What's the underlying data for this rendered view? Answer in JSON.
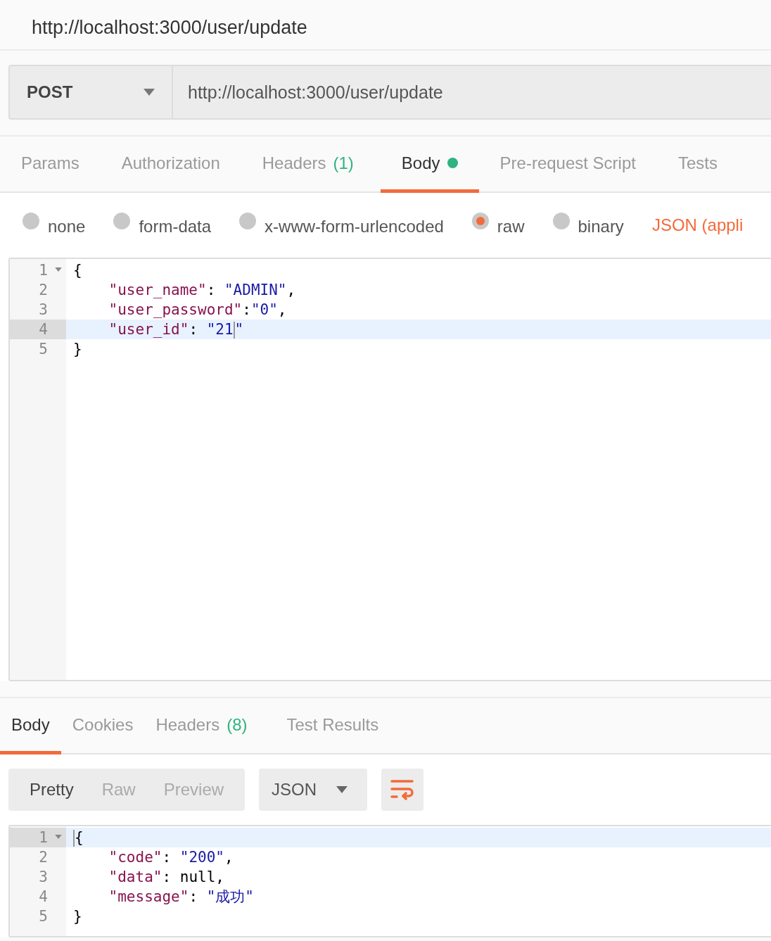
{
  "title": "http://localhost:3000/user/update",
  "request": {
    "method": "POST",
    "url": "http://localhost:3000/user/update"
  },
  "request_tabs": [
    {
      "label": "Params",
      "selected": false,
      "modified": false
    },
    {
      "label": "Authorization",
      "selected": false,
      "modified": false
    },
    {
      "label": "Headers",
      "count": "(1)",
      "selected": false,
      "modified": false
    },
    {
      "label": "Body",
      "selected": true,
      "modified": true
    },
    {
      "label": "Pre-request Script",
      "selected": false,
      "modified": false
    },
    {
      "label": "Tests",
      "selected": false,
      "modified": false
    }
  ],
  "body_modes": [
    {
      "label": "none",
      "selected": false
    },
    {
      "label": "form-data",
      "selected": false
    },
    {
      "label": "x-www-form-urlencoded",
      "selected": false
    },
    {
      "label": "raw",
      "selected": true
    },
    {
      "label": "binary",
      "selected": false
    }
  ],
  "content_type": "JSON (appli",
  "request_editor": {
    "lines": [
      {
        "number": "1",
        "foldable": true,
        "active": false,
        "tokens": [
          {
            "kind": "punct",
            "text": "{"
          }
        ]
      },
      {
        "number": "2",
        "foldable": false,
        "active": false,
        "tokens": [
          {
            "kind": "key",
            "text": "    \"user_name\""
          },
          {
            "kind": "punct",
            "text": ": "
          },
          {
            "kind": "string",
            "text": "\"ADMIN\""
          },
          {
            "kind": "punct",
            "text": ","
          }
        ]
      },
      {
        "number": "3",
        "foldable": false,
        "active": false,
        "tokens": [
          {
            "kind": "key",
            "text": "    \"user_password\""
          },
          {
            "kind": "punct",
            "text": ":"
          },
          {
            "kind": "string",
            "text": "\"0\""
          },
          {
            "kind": "punct",
            "text": ","
          }
        ]
      },
      {
        "number": "4",
        "foldable": false,
        "active": true,
        "tokens": [
          {
            "kind": "key",
            "text": "    \"user_id\""
          },
          {
            "kind": "punct",
            "text": ": "
          },
          {
            "kind": "string",
            "text": "\"21"
          },
          {
            "kind": "cursor"
          },
          {
            "kind": "string",
            "text": "\""
          }
        ]
      },
      {
        "number": "5",
        "foldable": false,
        "active": false,
        "tokens": [
          {
            "kind": "punct",
            "text": "}"
          }
        ]
      }
    ]
  },
  "response_tabs": [
    {
      "label": "Body",
      "selected": true
    },
    {
      "label": "Cookies",
      "selected": false
    },
    {
      "label": "Headers",
      "count": "(8)",
      "selected": false
    },
    {
      "label": "Test Results",
      "selected": false
    }
  ],
  "view_modes": [
    {
      "label": "Pretty",
      "selected": true
    },
    {
      "label": "Raw",
      "selected": false
    },
    {
      "label": "Preview",
      "selected": false
    }
  ],
  "response_format": "JSON",
  "response_editor": {
    "lines": [
      {
        "number": "1",
        "foldable": true,
        "active": true,
        "tokens": [
          {
            "kind": "cursor"
          },
          {
            "kind": "punct",
            "text": "{"
          }
        ]
      },
      {
        "number": "2",
        "foldable": false,
        "active": false,
        "tokens": [
          {
            "kind": "key",
            "text": "    \"code\""
          },
          {
            "kind": "punct",
            "text": ": "
          },
          {
            "kind": "string",
            "text": "\"200\""
          },
          {
            "kind": "punct",
            "text": ","
          }
        ]
      },
      {
        "number": "3",
        "foldable": false,
        "active": false,
        "tokens": [
          {
            "kind": "key",
            "text": "    \"data\""
          },
          {
            "kind": "punct",
            "text": ": "
          },
          {
            "kind": "null",
            "text": "null"
          },
          {
            "kind": "punct",
            "text": ","
          }
        ]
      },
      {
        "number": "4",
        "foldable": false,
        "active": false,
        "tokens": [
          {
            "kind": "key",
            "text": "    \"message\""
          },
          {
            "kind": "punct",
            "text": ": "
          },
          {
            "kind": "string",
            "text": "\"成功\""
          }
        ]
      },
      {
        "number": "5",
        "foldable": false,
        "active": false,
        "tokens": [
          {
            "kind": "punct",
            "text": "}"
          }
        ]
      }
    ]
  }
}
